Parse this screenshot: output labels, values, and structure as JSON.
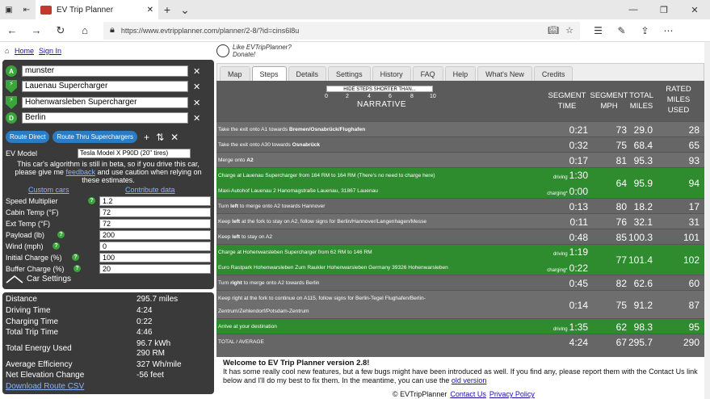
{
  "browser": {
    "tab_title": "EV Trip Planner",
    "url": "https://www.evtripplanner.com/planner/2-8/?id=cins6l8u"
  },
  "top_links": {
    "home": "Home",
    "sign_in": "Sign In"
  },
  "waypoints": [
    {
      "marker": "A",
      "value": "munster"
    },
    {
      "marker": "",
      "value": "Lauenau Supercharger"
    },
    {
      "marker": "",
      "value": "Hohenwarsleben Supercharger"
    },
    {
      "marker": "D",
      "value": "Berlin"
    }
  ],
  "buttons": {
    "route_direct": "Route Direct",
    "route_thru": "Route Thru Superchargers"
  },
  "ev_model": {
    "label": "EV Model",
    "selected": "Tesla Model X P90D (20\" tires)"
  },
  "beta_notice": {
    "part1": "This car's algorithm is still in beta, so if you drive this car, please give me ",
    "link": "feedback",
    "part2": " and use caution when relying on these estimates."
  },
  "sublinks": {
    "custom_cars": "Custom cars",
    "contribute": "Contribute data"
  },
  "params": [
    {
      "label": "Speed Multiplier",
      "value": "1.2"
    },
    {
      "label": "Cabin Temp (°F)",
      "value": "72"
    },
    {
      "label": "Ext Temp (°F)",
      "value": "72"
    },
    {
      "label": "Payload (lb)",
      "value": "200"
    },
    {
      "label": "Wind (mph)",
      "value": "0"
    },
    {
      "label": "Initial Charge (%)",
      "value": "100"
    },
    {
      "label": "Buffer Charge (%)",
      "value": "20"
    }
  ],
  "car_settings": "Car Settings",
  "summary": [
    {
      "label": "Distance",
      "value": "295.7 miles"
    },
    {
      "label": "Driving Time",
      "value": "4:24"
    },
    {
      "label": "Charging Time",
      "value": "0:22"
    },
    {
      "label": "Total Trip Time",
      "value": "4:46"
    },
    {
      "label": "Total Energy Used",
      "value": "96.7 kWh",
      "value2": "290 RM"
    },
    {
      "label": "Average Efficiency",
      "value": "327 Wh/mile"
    },
    {
      "label": "Net Elevation Change",
      "value": "-56 feet"
    }
  ],
  "download": "Download Route CSV",
  "promo": {
    "line1": "Like EVTripPlanner?",
    "line2": "Donate!"
  },
  "tabs": [
    "Map",
    "Steps",
    "Details",
    "Settings",
    "History",
    "FAQ",
    "Help",
    "What's New",
    "Credits"
  ],
  "steps_header": {
    "hide_btn": "HIDE STEPS SHORTER THAN...",
    "scale": [
      "0",
      "2",
      "4",
      "6",
      "8",
      "10"
    ],
    "narrative": "NARRATIVE",
    "seg_time": [
      "SEGMENT",
      "TIME"
    ],
    "seg_mph": [
      "SEGMENT",
      "MPH"
    ],
    "total_miles": [
      "TOTAL",
      "MILES"
    ],
    "rated": [
      "RATED",
      "MILES",
      "USED"
    ]
  },
  "steps": [
    {
      "kind": "dark",
      "pre": "Take the exit onto A1 towards ",
      "b": "Bremen/Osnabrück/Flughafen",
      "post": "",
      "time": "0:21",
      "mph": "73",
      "miles": "29.0",
      "rated": "28"
    },
    {
      "kind": "light",
      "pre": "Take the exit onto A30 towards ",
      "b": "Osnabrück",
      "post": "",
      "time": "0:32",
      "mph": "75",
      "miles": "68.4",
      "rated": "65"
    },
    {
      "kind": "dark",
      "pre": "Merge onto ",
      "b": "A2",
      "post": "",
      "time": "0:17",
      "mph": "81",
      "miles": "95.3",
      "rated": "93"
    },
    {
      "kind": "green",
      "line1": "Charge at Lauenau Supercharger from 164 RM to 164 RM (There's no need to charge here)",
      "line2": "Maxi-Autohof Lauenau 2 Hanomagstraße Lauenau, 31867 Lauenau",
      "lbl1": "driving",
      "time": "1:30",
      "lbl2": "charging*",
      "time2": "0:00",
      "mph": "64",
      "miles": "95.9",
      "rated": "94"
    },
    {
      "kind": "light",
      "pre": "Turn ",
      "b": "left",
      "post": " to merge onto A2 towards Hannover",
      "time": "0:13",
      "mph": "80",
      "miles": "18.2",
      "rated": "17"
    },
    {
      "kind": "dark",
      "pre": "Keep ",
      "b": "left",
      "post": " at the fork to stay on A2, follow signs for Berlin/Hannover/Langenhagen/Messe",
      "time": "0:11",
      "mph": "76",
      "miles": "32.1",
      "rated": "31"
    },
    {
      "kind": "light",
      "pre": "Keep ",
      "b": "left",
      "post": " to stay on A2",
      "time": "0:48",
      "mph": "85",
      "miles": "100.3",
      "rated": "101"
    },
    {
      "kind": "green",
      "line1": "Charge at Hohenwarsleben Supercharger from 62 RM to 146 RM",
      "line2": "Euro Rastpark Hohenwarsleben Zum Raukler Hohenwarsleben Germany 39326 Hohenwarsleben",
      "lbl1": "driving",
      "time": "1:19",
      "lbl2": "charging*",
      "time2": "0:22",
      "mph": "77",
      "miles": "101.4",
      "rated": "102"
    },
    {
      "kind": "light",
      "pre": "Turn ",
      "b": "right",
      "post": " to merge onto A2 towards Berlin",
      "time": "0:45",
      "mph": "82",
      "miles": "62.6",
      "rated": "60"
    },
    {
      "kind": "dark",
      "line1": "Keep right at the fork to continue on A115, follow signs for Berlin-Tegel Flughafen/Berlin-",
      "line2": "Zentrum/Zehlendorf/Potsdam-Zentrum",
      "time": "0:14",
      "mph": "75",
      "miles": "91.2",
      "rated": "87"
    },
    {
      "kind": "green",
      "pre": "Arrive at your destination",
      "b": "",
      "post": "",
      "lbl1": "driving",
      "time": "1:35",
      "mph": "62",
      "miles": "98.3",
      "rated": "95"
    },
    {
      "kind": "light",
      "pre": "TOTAL / AVERAGE",
      "b": "",
      "post": "",
      "time": "4:24",
      "mph": "67",
      "miles": "295.7",
      "rated": "290"
    }
  ],
  "welcome": {
    "title": "Welcome to EV Trip Planner version 2.8!",
    "body": "It has some really cool new features, but a few bugs might have been introduced as well. If you find any, please report them with the Contact Us link below and I'll do my best to fix them. In the meantime, you can use the ",
    "link": "old version"
  },
  "footer": {
    "copy": "© EVTripPlanner",
    "contact": "Contact Us",
    "privacy": "Privacy Policy"
  }
}
